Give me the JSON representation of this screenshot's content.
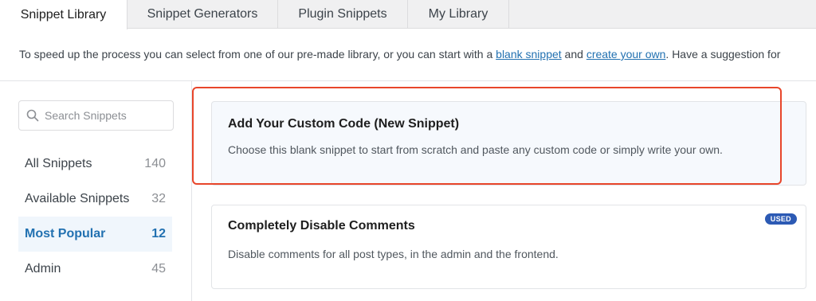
{
  "tabs": [
    {
      "label": "Snippet Library",
      "active": true
    },
    {
      "label": "Snippet Generators",
      "active": false
    },
    {
      "label": "Plugin Snippets",
      "active": false
    },
    {
      "label": "My Library",
      "active": false
    }
  ],
  "intro": {
    "text_before": "To speed up the process you can select from one of our pre-made library, or you can start with a ",
    "link_blank": "blank snippet",
    "text_middle": " and ",
    "link_create": "create your own",
    "text_after": ". Have a suggestion for"
  },
  "search": {
    "placeholder": "Search Snippets",
    "value": ""
  },
  "categories": [
    {
      "label": "All Snippets",
      "count": "140",
      "active": false
    },
    {
      "label": "Available Snippets",
      "count": "32",
      "active": false
    },
    {
      "label": "Most Popular",
      "count": "12",
      "active": true
    },
    {
      "label": "Admin",
      "count": "45",
      "active": false
    }
  ],
  "cards": {
    "custom": {
      "title": "Add Your Custom Code (New Snippet)",
      "description": "Choose this blank snippet to start from scratch and paste any custom code or simply write your own."
    },
    "disable_comments": {
      "title": "Completely Disable Comments",
      "description": "Disable comments for all post types, in the admin and the frontend.",
      "badge": "USED"
    }
  },
  "icons": {
    "search": "search-icon"
  },
  "colors": {
    "accent": "#2271b1",
    "highlight": "#e8462b",
    "badge": "#2c5ab4"
  }
}
